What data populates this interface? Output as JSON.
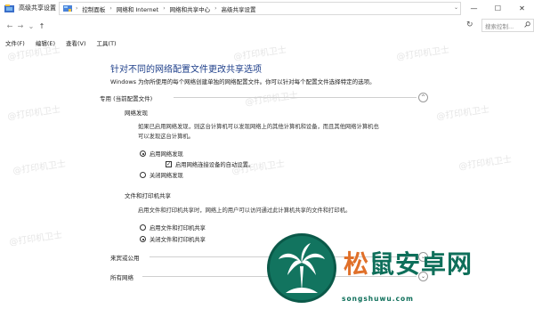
{
  "window": {
    "title": "高级共享设置",
    "controls": {
      "minimize": "—",
      "maximize": "☐",
      "close": "✕"
    }
  },
  "nav": {
    "back": "←",
    "forward": "→",
    "history": "⌄",
    "up": "↑",
    "breadcrumbs": [
      "控制面板",
      "网络和 Internet",
      "网络和共享中心",
      "高级共享设置"
    ],
    "separator": "›",
    "refresh": "↻",
    "search_placeholder": "搜索控制..."
  },
  "menu": [
    "文件(F)",
    "编辑(E)",
    "查看(V)",
    "工具(T)"
  ],
  "content": {
    "heading": "针对不同的网络配置文件更改共享选项",
    "description": "Windows 为你所使用的每个网络创建单独的网络配置文件。你可以针对每个配置文件选择特定的选项。",
    "profile_private": {
      "label": "专用 (当前配置文件)",
      "toggle": "^",
      "discovery": {
        "heading": "网络发现",
        "para_line1": "如果已启用网络发现，则这台计算机可以发现网络上的其他计算机和设备，而且其他网络计算机也",
        "para_line2": "可以发现这台计算机。",
        "opt_on": "启用网络发现",
        "opt_auto": "启用网络连接设备的自动设置。",
        "opt_off": "关闭网络发现"
      },
      "sharing": {
        "heading": "文件和打印机共享",
        "para": "启用文件和打印机共享时，网络上的用户可以访问通过此计算机共享的文件和打印机。",
        "opt_on": "启用文件和打印机共享",
        "opt_off": "关闭文件和打印机共享"
      }
    },
    "profile_guest": {
      "label": "来宾或公用",
      "toggle": "⌄"
    },
    "profile_all": {
      "label": "所有网络",
      "toggle": "⌄"
    }
  },
  "watermark": "@打印机卫士",
  "logo": {
    "text_accent": "松",
    "text_main": "鼠安卓网",
    "subtitle": "songshuwu.com",
    "colors": {
      "green": "#12745f",
      "orange": "#e0702a"
    }
  },
  "icons": {
    "app": "network-folder-icon",
    "crumb": "control-panel-icon",
    "search": "magnifier-icon"
  },
  "colors": {
    "heading": "#1e3f8a",
    "border": "#d9d9d9"
  }
}
